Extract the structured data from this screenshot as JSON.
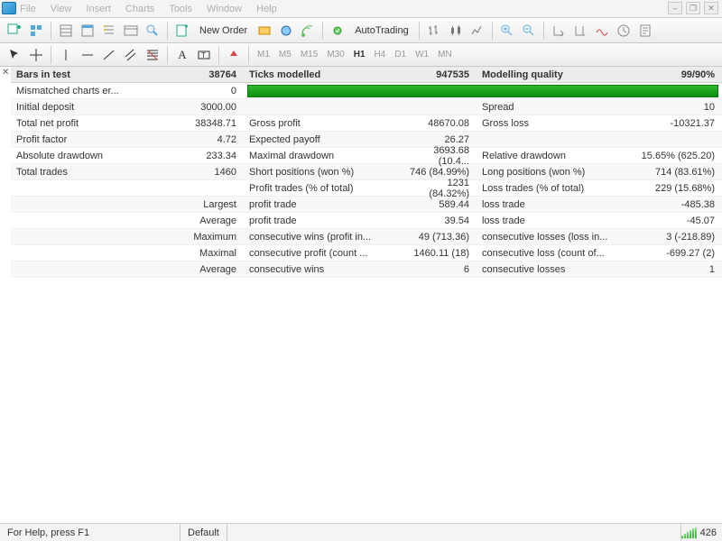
{
  "menu": {
    "file": "File",
    "view": "View",
    "insert": "Insert",
    "charts": "Charts",
    "tools": "Tools",
    "window": "Window",
    "help": "Help"
  },
  "toolbar": {
    "new_order": "New Order",
    "autotrading": "AutoTrading"
  },
  "timeframes": {
    "m1": "M1",
    "m5": "M5",
    "m15": "M15",
    "m30": "M30",
    "h1": "H1",
    "h4": "H4",
    "d1": "D1",
    "w1": "W1",
    "mn": "MN"
  },
  "report": {
    "headers": {
      "bars": "Bars in test",
      "ticks": "Ticks modelled",
      "quality": "Modelling quality"
    },
    "head_vals": {
      "bars": "38764",
      "ticks": "947535",
      "quality": "99/90%"
    },
    "rows": [
      {
        "l1": "Mismatched charts er...",
        "v1": "0",
        "progress": true
      },
      {
        "l1": "Initial deposit",
        "v1": "3000.00",
        "l2": "",
        "v2": "",
        "l3": "Spread",
        "v3": "10"
      },
      {
        "l1": "Total net profit",
        "v1": "38348.71",
        "l2": "Gross profit",
        "v2": "48670.08",
        "l3": "Gross loss",
        "v3": "-10321.37"
      },
      {
        "l1": "Profit factor",
        "v1": "4.72",
        "l2": "Expected payoff",
        "v2": "26.27",
        "l3": "",
        "v3": ""
      },
      {
        "l1": "Absolute drawdown",
        "v1": "233.34",
        "l2": "Maximal drawdown",
        "v2": "3693.68 (10.4...",
        "l3": "Relative drawdown",
        "v3": "15.65% (625.20)"
      },
      {
        "l1": "Total trades",
        "v1": "1460",
        "l2": "Short positions (won %)",
        "v2": "746 (84.99%)",
        "l3": "Long positions (won %)",
        "v3": "714 (83.61%)"
      },
      {
        "l1": "",
        "v1": "",
        "l2": "Profit trades (% of total)",
        "v2": "1231 (84.32%)",
        "l3": "Loss trades (% of total)",
        "v3": "229 (15.68%)"
      },
      {
        "l1": "",
        "v1": "Largest",
        "l2": "profit trade",
        "v2": "589.44",
        "l3": "loss trade",
        "v3": "-485.38"
      },
      {
        "l1": "",
        "v1": "Average",
        "l2": "profit trade",
        "v2": "39.54",
        "l3": "loss trade",
        "v3": "-45.07"
      },
      {
        "l1": "",
        "v1": "Maximum",
        "l2": "consecutive wins (profit in...",
        "v2": "49 (713.36)",
        "l3": "consecutive losses (loss in...",
        "v3": "3 (-218.89)"
      },
      {
        "l1": "",
        "v1": "Maximal",
        "l2": "consecutive profit (count ...",
        "v2": "1460.11 (18)",
        "l3": "consecutive loss (count of...",
        "v3": "-699.27 (2)"
      },
      {
        "l1": "",
        "v1": "Average",
        "l2": "consecutive wins",
        "v2": "6",
        "l3": "consecutive losses",
        "v3": "1"
      }
    ]
  },
  "status": {
    "help": "For Help, press F1",
    "profile": "Default",
    "conn": "426"
  }
}
